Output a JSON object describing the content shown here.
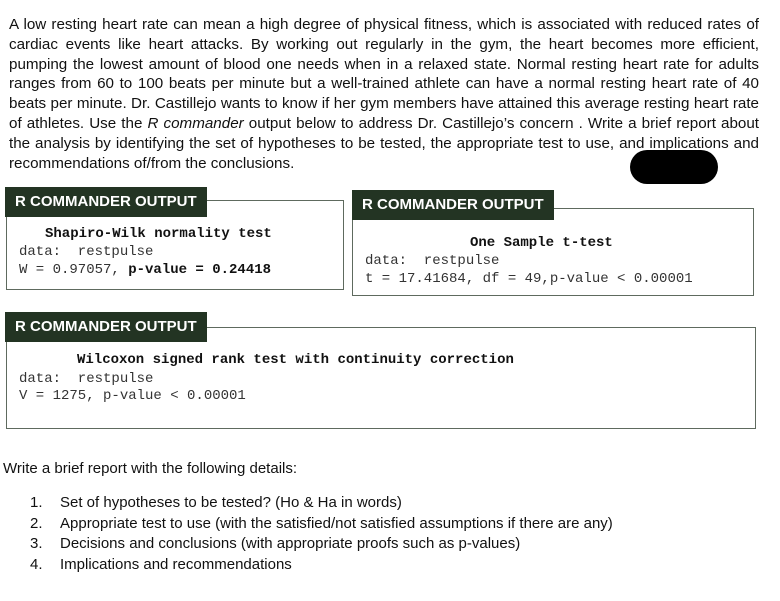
{
  "intro": {
    "part1": "A low resting heart rate can mean a high degree of physical fitness, which is associated with reduced rates of cardiac events like heart attacks. By working out regularly in the gym, the heart becomes more efficient, pumping the lowest amount of blood one needs when in a relaxed state. Normal resting heart rate for adults ranges from 60 to 100 beats per minute but a well-trained athlete can have a normal resting heart rate of 40 beats per minute. Dr. Castillejo wants to know if her gym members have attained this average  resting heart rate of athletes. Use the ",
    "italic": "R commander",
    "part2": " output below to address Dr. Castillejo’s concern . Write a brief report about the analysis by identifying the set of hypotheses to be tested, the appropriate test to use, and implications and recommendations of/from the conclusions."
  },
  "panels": {
    "shapiro": {
      "header": "R COMMANDER OUTPUT",
      "title": "Shapiro-Wilk normality test",
      "data_line": "data:  restpulse",
      "stat": "W = 0.97057, ",
      "pvalue": "p-value = 0.24418"
    },
    "ttest": {
      "header": "R COMMANDER OUTPUT",
      "title": "One Sample t-test",
      "data_line": "data:  restpulse",
      "stat_line": "t = 17.41684, df = 49,p-value < 0.00001"
    },
    "wilcoxon": {
      "header": "R COMMANDER OUTPUT",
      "title": "Wilcoxon signed rank test with continuity correction",
      "data_line": "data:  restpulse",
      "stat_line": "V = 1275, p-value < 0.00001"
    }
  },
  "instructions": {
    "heading": "Write a brief report with the following details:",
    "items": [
      {
        "num": "1.",
        "text": "Set of hypotheses to be tested? (Ho & Ha in words)"
      },
      {
        "num": "2.",
        "text": "Appropriate test to use (with the satisfied/not satisfied assumptions if there are any)"
      },
      {
        "num": "3.",
        "text": "Decisions and conclusions (with appropriate proofs such as p-values)"
      },
      {
        "num": "4.",
        "text": "Implications and recommendations"
      }
    ]
  },
  "colors": {
    "header_bg": "#233423",
    "panel_border": "#5e6a5e"
  }
}
